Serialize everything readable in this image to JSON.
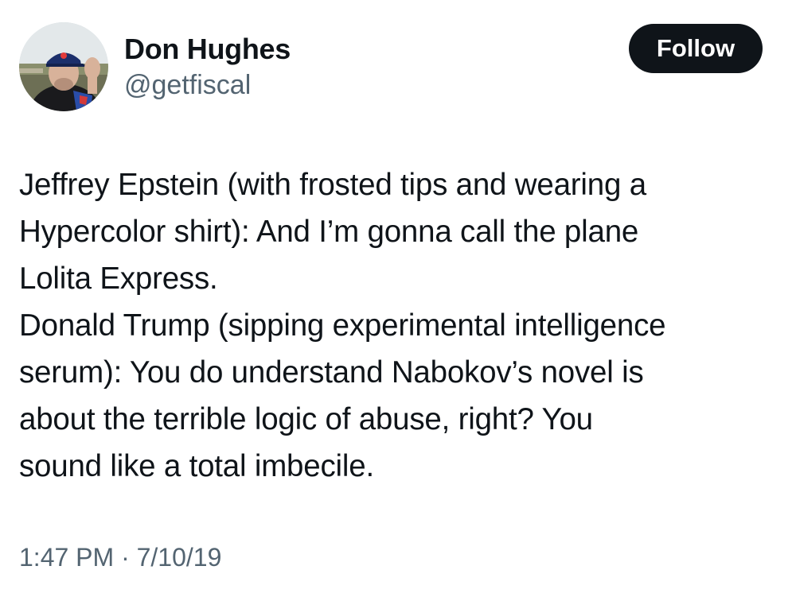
{
  "author": {
    "display_name": "Don Hughes",
    "handle": "@getfiscal",
    "avatar_icon": "profile-photo"
  },
  "follow_label": "Follow",
  "tweet": {
    "lines": [
      "Jeffrey Epstein (with frosted tips and wearing a",
      "Hypercolor shirt): And I’m gonna call the plane",
      "Lolita Express.",
      "Donald Trump (sipping experimental intelligence",
      "serum): You do understand Nabokov’s novel is",
      "about the terrible logic of abuse, right? You",
      "sound like a total imbecile."
    ],
    "time": "1:47 PM",
    "separator": "·",
    "date": "7/10/19"
  },
  "colors": {
    "text": "#0f1419",
    "secondary": "#536471",
    "button_bg": "#0f1419",
    "button_text": "#ffffff"
  }
}
